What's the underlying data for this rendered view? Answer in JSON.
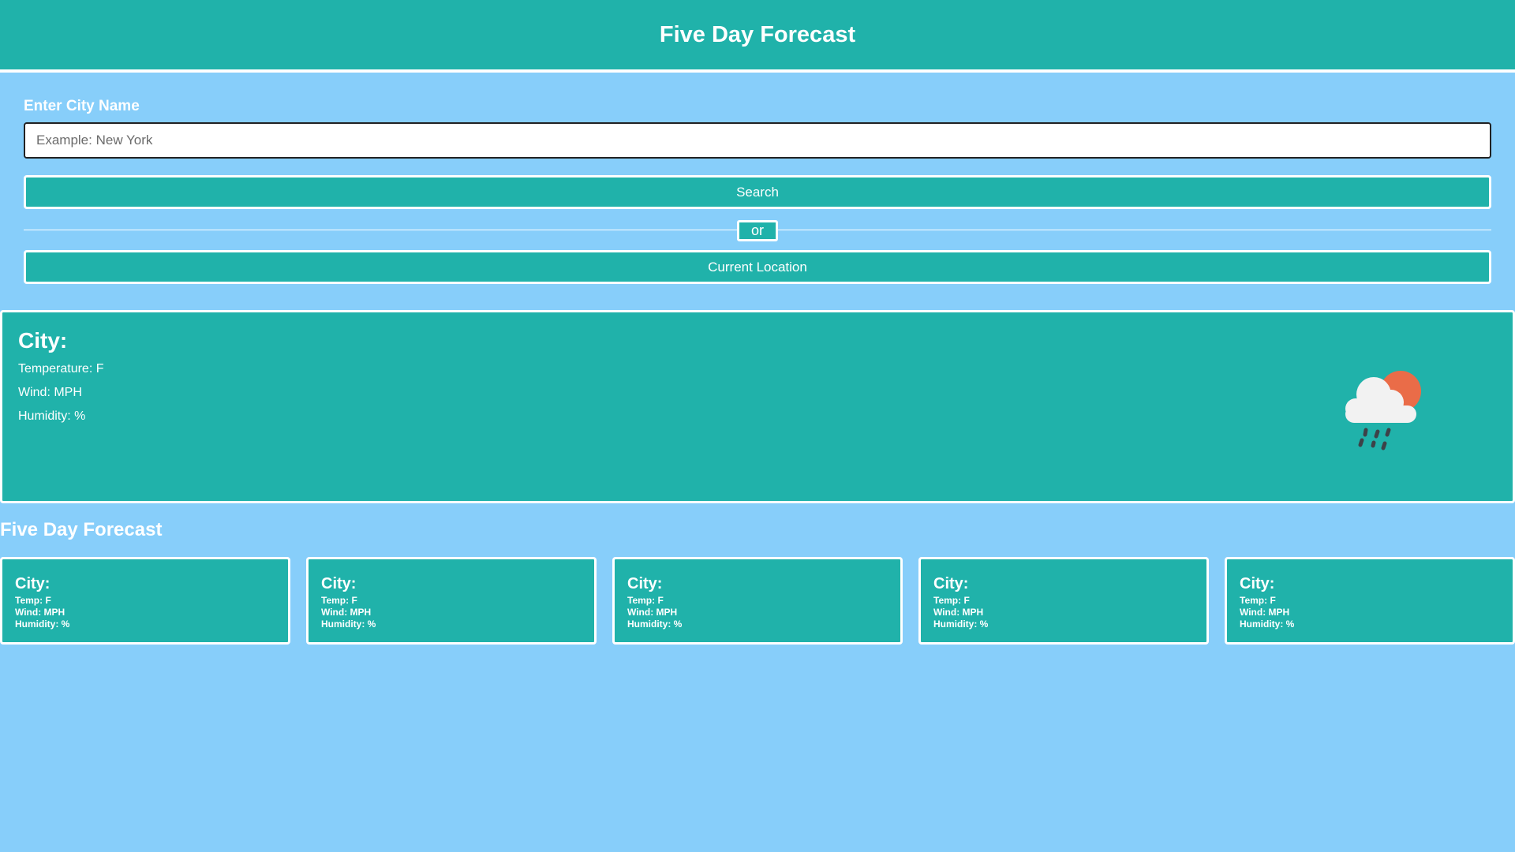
{
  "header": {
    "title": "Five Day Forecast"
  },
  "search": {
    "label": "Enter City Name",
    "placeholder": "Example: New York",
    "value": "",
    "search_button": "Search",
    "or_text": "or",
    "location_button": "Current Location"
  },
  "current": {
    "city": "City:",
    "temperature": "Temperature: F",
    "wind": "Wind: MPH",
    "humidity": "Humidity: %",
    "icon": "cloud-rain-sun-icon"
  },
  "forecast": {
    "heading": "Five Day Forecast",
    "days": [
      {
        "city": "City:",
        "temp": "Temp: F",
        "wind": "Wind: MPH",
        "humidity": "Humidity: %"
      },
      {
        "city": "City:",
        "temp": "Temp: F",
        "wind": "Wind: MPH",
        "humidity": "Humidity: %"
      },
      {
        "city": "City:",
        "temp": "Temp: F",
        "wind": "Wind: MPH",
        "humidity": "Humidity: %"
      },
      {
        "city": "City:",
        "temp": "Temp: F",
        "wind": "Wind: MPH",
        "humidity": "Humidity: %"
      },
      {
        "city": "City:",
        "temp": "Temp: F",
        "wind": "Wind: MPH",
        "humidity": "Humidity: %"
      }
    ]
  },
  "colors": {
    "background": "#87cefa",
    "panel": "#20b2aa",
    "border": "#ffffff",
    "sun": "#ea6c48",
    "cloud": "#f2f2f2",
    "rain": "#3d4248"
  }
}
